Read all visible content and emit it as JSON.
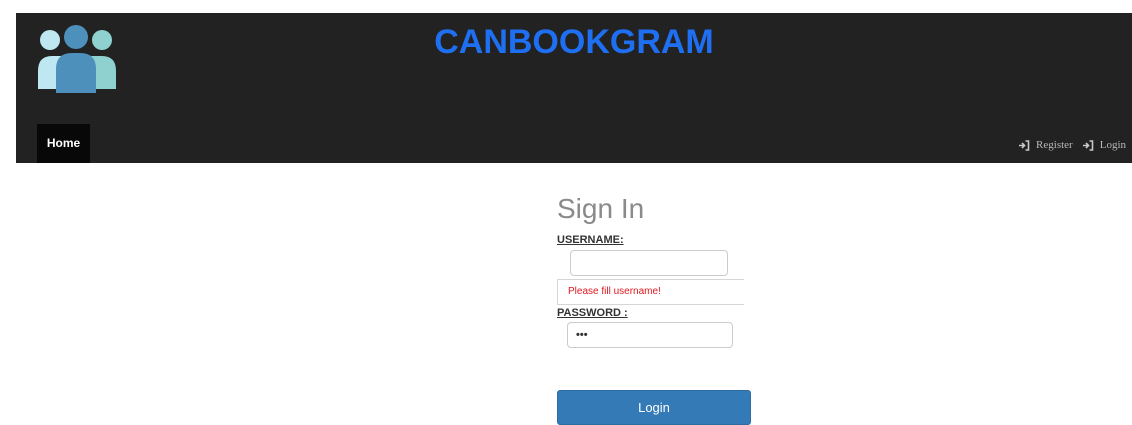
{
  "header": {
    "brand": "CANBOOKGRAM",
    "logo_icon": "users-group-icon",
    "nav": {
      "home_label": "Home",
      "register_label": "Register",
      "login_label": "Login",
      "link_icon": "sign-in-icon"
    }
  },
  "login_form": {
    "title": "Sign In",
    "username_label": "USERNAME:",
    "username_value": "",
    "username_error": "Please fill username!",
    "password_label": "PASSWORD :",
    "password_value": "•••",
    "submit_label": "Login"
  },
  "colors": {
    "header_bg": "#222222",
    "brand": "#1e6ff2",
    "button": "#337ab7",
    "error": "#e0181e"
  }
}
